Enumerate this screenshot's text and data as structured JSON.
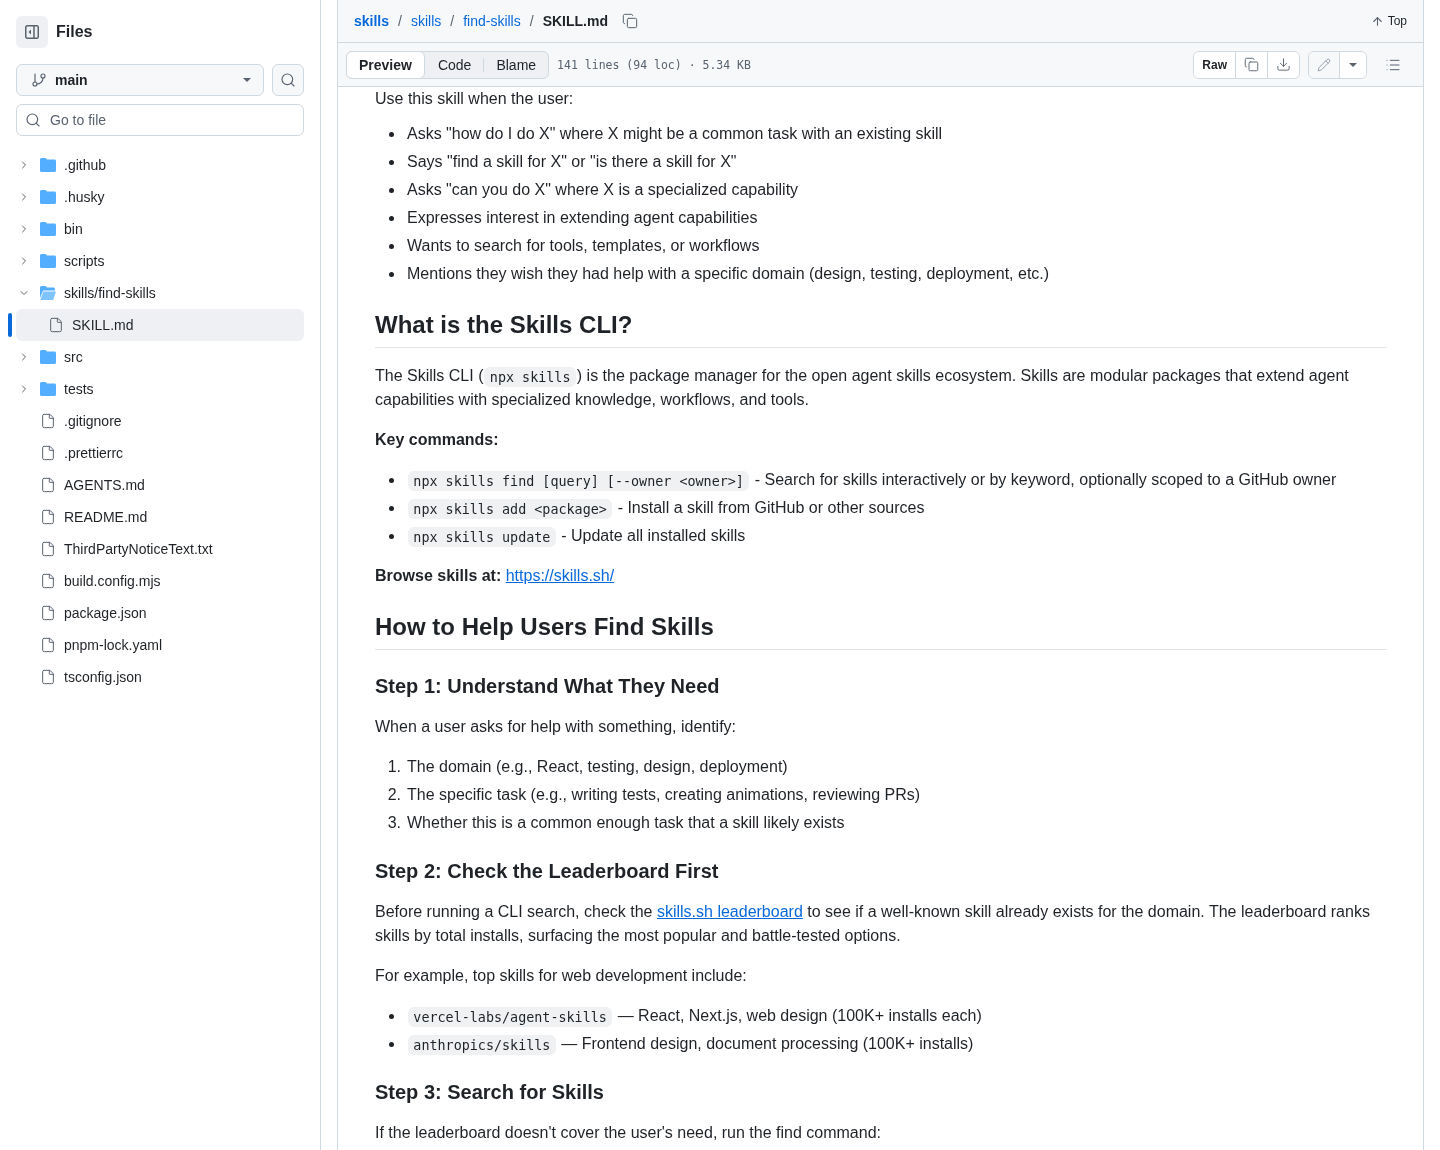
{
  "sidebar": {
    "title": "Files",
    "branch": "main",
    "search": {
      "placeholder": "Go to file"
    },
    "tree": [
      {
        "name": ".github",
        "kind": "folder",
        "expanded": false,
        "selected": false
      },
      {
        "name": ".husky",
        "kind": "folder",
        "expanded": false,
        "selected": false
      },
      {
        "name": "bin",
        "kind": "folder",
        "expanded": false,
        "selected": false
      },
      {
        "name": "scripts",
        "kind": "folder",
        "expanded": false,
        "selected": false
      },
      {
        "name": "skills/find-skills",
        "kind": "folder",
        "expanded": true,
        "selected": false,
        "children": [
          {
            "name": "SKILL.md",
            "kind": "file",
            "selected": true
          }
        ]
      },
      {
        "name": "src",
        "kind": "folder",
        "expanded": false,
        "selected": false
      },
      {
        "name": "tests",
        "kind": "folder",
        "expanded": false,
        "selected": false
      },
      {
        "name": ".gitignore",
        "kind": "file",
        "selected": false
      },
      {
        "name": ".prettierrc",
        "kind": "file",
        "selected": false
      },
      {
        "name": "AGENTS.md",
        "kind": "file",
        "selected": false
      },
      {
        "name": "README.md",
        "kind": "file",
        "selected": false
      },
      {
        "name": "ThirdPartyNoticeText.txt",
        "kind": "file",
        "selected": false
      },
      {
        "name": "build.config.mjs",
        "kind": "file",
        "selected": false
      },
      {
        "name": "package.json",
        "kind": "file",
        "selected": false
      },
      {
        "name": "pnpm-lock.yaml",
        "kind": "file",
        "selected": false
      },
      {
        "name": "tsconfig.json",
        "kind": "file",
        "selected": false
      }
    ]
  },
  "header": {
    "breadcrumb": [
      {
        "kind": "repo",
        "text": "skills"
      },
      {
        "kind": "separator",
        "text": "/"
      },
      {
        "kind": "dir",
        "text": "skills"
      },
      {
        "kind": "separator",
        "text": "/"
      },
      {
        "kind": "dir",
        "text": "find-skills"
      },
      {
        "kind": "separator",
        "text": "/"
      },
      {
        "kind": "file",
        "text": "SKILL.md"
      }
    ],
    "top_button": "Top"
  },
  "toolbar": {
    "tabs": [
      {
        "label": "Preview",
        "selected": true
      },
      {
        "label": "Code",
        "selected": false
      },
      {
        "label": "Blame",
        "selected": false
      }
    ],
    "file_info": "141 lines (94 loc) · 5.34 KB",
    "raw_button": "Raw"
  },
  "content": [
    {
      "kind": "paragraph",
      "parts": [
        {
          "kind": "text",
          "text": "Use this skill when the user:"
        }
      ]
    },
    {
      "kind": "bullets",
      "items": [
        {
          "parts": [
            {
              "kind": "text",
              "text": "Asks \"how do I do X\" where X might be a common task with an existing skill"
            }
          ]
        },
        {
          "parts": [
            {
              "kind": "text",
              "text": "Says \"find a skill for X\" or \"is there a skill for X\""
            }
          ]
        },
        {
          "parts": [
            {
              "kind": "text",
              "text": "Asks \"can you do X\" where X is a specialized capability"
            }
          ]
        },
        {
          "parts": [
            {
              "kind": "text",
              "text": "Expresses interest in extending agent capabilities"
            }
          ]
        },
        {
          "parts": [
            {
              "kind": "text",
              "text": "Wants to search for tools, templates, or workflows"
            }
          ]
        },
        {
          "parts": [
            {
              "kind": "text",
              "text": "Mentions they wish they had help with a specific domain (design, testing, deployment, etc.)"
            }
          ]
        }
      ]
    },
    {
      "kind": "heading2",
      "text": "What is the Skills CLI?"
    },
    {
      "kind": "paragraph",
      "parts": [
        {
          "kind": "text",
          "text": "The Skills CLI ("
        },
        {
          "kind": "code",
          "text": "npx skills"
        },
        {
          "kind": "text",
          "text": ") is the package manager for the open agent skills ecosystem. Skills are modular packages that extend agent capabilities with specialized knowledge, workflows, and tools."
        }
      ]
    },
    {
      "kind": "paragraph",
      "parts": [
        {
          "kind": "bold",
          "text": "Key commands:"
        }
      ]
    },
    {
      "kind": "bullets",
      "items": [
        {
          "parts": [
            {
              "kind": "code",
              "text": "npx skills find [query] [--owner <owner>]"
            },
            {
              "kind": "text",
              "text": " - Search for skills interactively or by keyword, optionally scoped to a GitHub owner"
            }
          ]
        },
        {
          "parts": [
            {
              "kind": "code",
              "text": "npx skills add <package>"
            },
            {
              "kind": "text",
              "text": " - Install a skill from GitHub or other sources"
            }
          ]
        },
        {
          "parts": [
            {
              "kind": "code",
              "text": "npx skills update"
            },
            {
              "kind": "text",
              "text": " - Update all installed skills"
            }
          ]
        }
      ]
    },
    {
      "kind": "paragraph",
      "parts": [
        {
          "kind": "bold",
          "text": "Browse skills at: "
        },
        {
          "kind": "link",
          "text": "https://skills.sh/"
        }
      ]
    },
    {
      "kind": "heading2",
      "text": "How to Help Users Find Skills"
    },
    {
      "kind": "heading3",
      "text": "Step 1: Understand What They Need"
    },
    {
      "kind": "paragraph",
      "parts": [
        {
          "kind": "text",
          "text": "When a user asks for help with something, identify:"
        }
      ]
    },
    {
      "kind": "numbered",
      "items": [
        {
          "marker": "1.",
          "parts": [
            {
              "kind": "text",
              "text": "The domain (e.g., React, testing, design, deployment)"
            }
          ]
        },
        {
          "marker": "2.",
          "parts": [
            {
              "kind": "text",
              "text": "The specific task (e.g., writing tests, creating animations, reviewing PRs)"
            }
          ]
        },
        {
          "marker": "3.",
          "parts": [
            {
              "kind": "text",
              "text": "Whether this is a common enough task that a skill likely exists"
            }
          ]
        }
      ]
    },
    {
      "kind": "heading3",
      "text": "Step 2: Check the Leaderboard First"
    },
    {
      "kind": "paragraph",
      "parts": [
        {
          "kind": "text",
          "text": "Before running a CLI search, check the "
        },
        {
          "kind": "link",
          "text": "skills.sh leaderboard"
        },
        {
          "kind": "text",
          "text": " to see if a well-known skill already exists for the domain. The leaderboard ranks skills by total installs, surfacing the most popular and battle-tested options."
        }
      ]
    },
    {
      "kind": "paragraph",
      "parts": [
        {
          "kind": "text",
          "text": "For example, top skills for web development include:"
        }
      ]
    },
    {
      "kind": "bullets",
      "items": [
        {
          "parts": [
            {
              "kind": "code",
              "text": "vercel-labs/agent-skills"
            },
            {
              "kind": "text",
              "text": " — React, Next.js, web design (100K+ installs each)"
            }
          ]
        },
        {
          "parts": [
            {
              "kind": "code",
              "text": "anthropics/skills"
            },
            {
              "kind": "text",
              "text": " — Frontend design, document processing (100K+ installs)"
            }
          ]
        }
      ]
    },
    {
      "kind": "heading3",
      "text": "Step 3: Search for Skills"
    },
    {
      "kind": "paragraph",
      "parts": [
        {
          "kind": "text",
          "text": "If the leaderboard doesn't cover the user's need, run the find command:"
        }
      ]
    }
  ]
}
